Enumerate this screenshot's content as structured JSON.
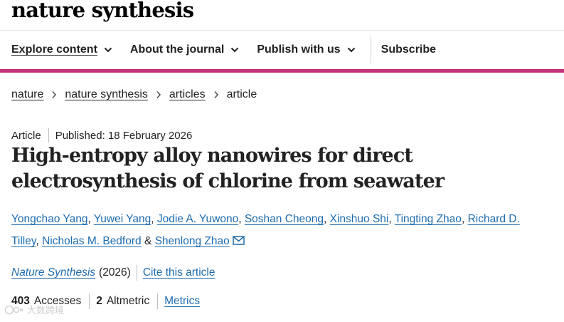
{
  "header": {
    "logo_text": "nature synthesis"
  },
  "nav": {
    "items": [
      {
        "label": "Explore content"
      },
      {
        "label": "About the journal"
      },
      {
        "label": "Publish with us"
      }
    ],
    "subscribe_label": "Subscribe"
  },
  "breadcrumb": {
    "items": [
      "nature",
      "nature synthesis",
      "articles"
    ],
    "current": "article"
  },
  "article": {
    "type": "Article",
    "published": "Published: 18 February 2026",
    "title": "High-entropy alloy nanowires for direct electrosynthesis of chlorine from seawater",
    "authors": [
      "Yongchao Yang",
      "Yuwei Yang",
      "Jodie A. Yuwono",
      "Soshan Cheong",
      "Xinshuo Shi",
      "Tingting Zhao",
      "Richard D. Tilley",
      "Nicholas M. Bedford",
      "Shenlong Zhao"
    ],
    "author_separator": ", ",
    "author_last_separator": " & ",
    "journal": "Nature Synthesis",
    "year": "(2026)",
    "cite_label": "Cite this article"
  },
  "metrics": {
    "accesses_count": "403",
    "accesses_label": "Accesses",
    "altmetric_count": "2",
    "altmetric_label": "Altmetric",
    "metrics_link": "Metrics"
  },
  "watermark": {
    "text": "大数跨境"
  },
  "icons": {
    "nav_chevron": "chevron-down-icon",
    "breadcrumb_separator": "chevron-right-icon",
    "corresponding_author": "mail-icon"
  },
  "colors": {
    "accent_bar": "#c4327d",
    "link": "#1e6caf",
    "text": "#222222"
  }
}
